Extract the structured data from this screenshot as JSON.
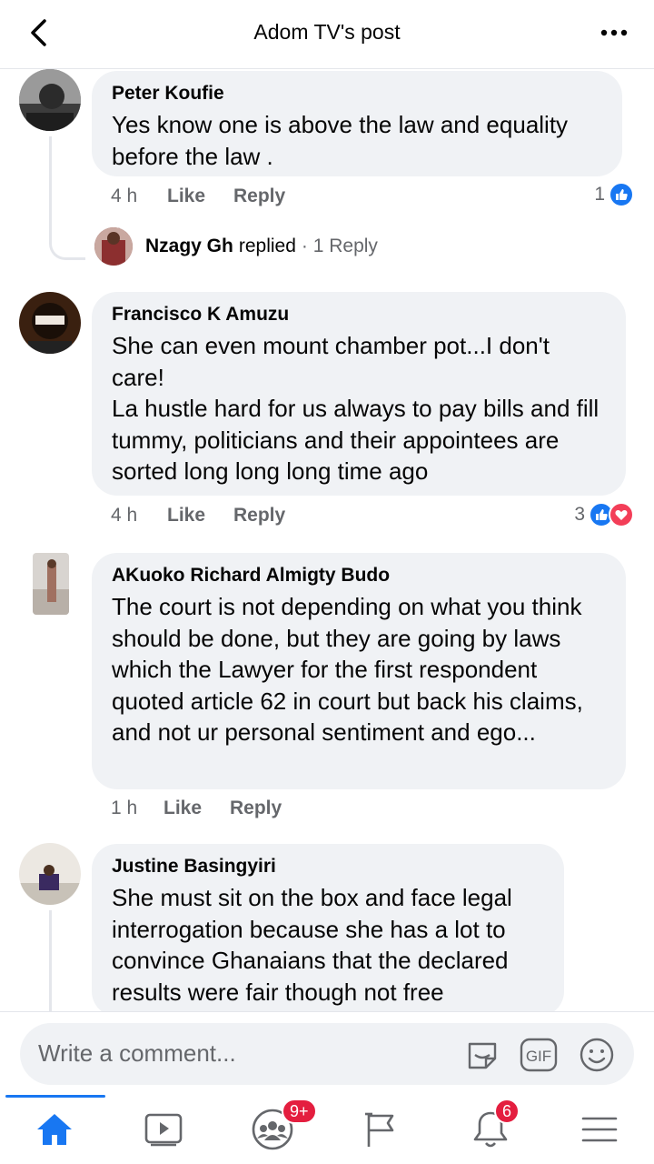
{
  "header": {
    "title": "Adom TV's post"
  },
  "comments": [
    {
      "author": "Peter Koufie",
      "text": "Yes know one is above the law and equality before the law .",
      "time": "4 h",
      "like_label": "Like",
      "reply_label": "Reply",
      "reaction_count": "1",
      "reply_summary": {
        "name": "Nzagy Gh",
        "verb": "replied",
        "count": "· 1 Reply"
      }
    },
    {
      "author": "Francisco K Amuzu",
      "text_lines": [
        "She can even mount chamber pot...I don't care!",
        "La hustle hard for us always to pay bills and fill tummy, politicians and their appointees are sorted long long long time ago"
      ],
      "time": "4 h",
      "like_label": "Like",
      "reply_label": "Reply",
      "reaction_count": "3"
    },
    {
      "author": "AKuoko Richard Almigty Budo",
      "text": "The court is not depending on what you think should be done, but they are going by laws which the Lawyer for the first respondent quoted article 62 in court but back his claims, and not ur personal sentiment and ego...",
      "time": "1 h",
      "like_label": "Like",
      "reply_label": "Reply"
    },
    {
      "author": "Justine Basingyiri",
      "text": "She must sit on the box and face legal interrogation because she has a lot to convince Ghanaians that the declared results were fair though not free"
    }
  ],
  "composer": {
    "placeholder": "Write a comment...",
    "gif_label": "GIF"
  },
  "nav": {
    "groups_badge": "9+",
    "notifications_badge": "6"
  },
  "colors": {
    "accent": "#1877f2",
    "love": "#f33e58",
    "badge": "#e41e3f",
    "bubble": "#f0f2f5",
    "meta_text": "#65676b"
  }
}
